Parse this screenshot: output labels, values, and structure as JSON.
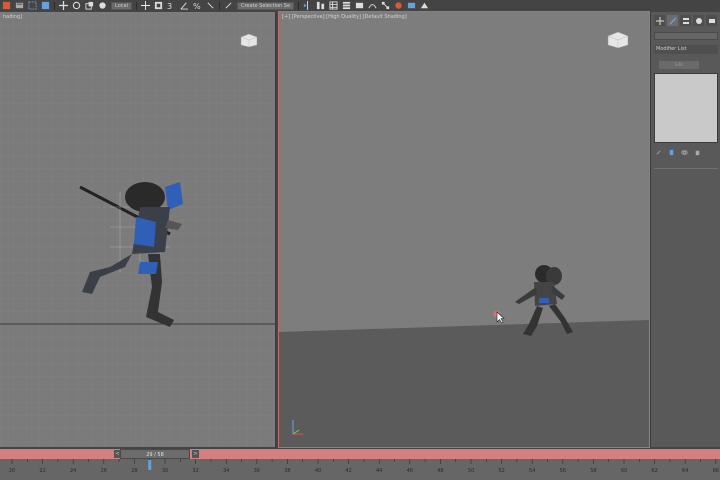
{
  "toolbar": {
    "reference_coord_system": "Local",
    "selection_set_placeholder": "Create Selection Se"
  },
  "viewport_left": {
    "label": "hading]"
  },
  "viewport_right": {
    "label": "[+] [Perspective] [High Quality] [Default Shading]"
  },
  "command_panel": {
    "modifier_list_label": "Modifier List",
    "pin_button_label": "Edit"
  },
  "time_slider": {
    "frame_display": "29 / 58",
    "prev_label": "<",
    "next_label": ">"
  },
  "track_bar": {
    "tick_labels": [
      "20",
      "22",
      "24",
      "26",
      "28",
      "30",
      "32",
      "34",
      "36",
      "38",
      "40",
      "42",
      "44",
      "46",
      "48",
      "50",
      "52",
      "54",
      "56",
      "58",
      "60",
      "62",
      "64",
      "66"
    ],
    "current_frame": 29
  },
  "colors": {
    "active_viewport_border": "#c06a6a",
    "time_slider_bg": "#d67f7f",
    "character_accent": "#2f5fb7"
  }
}
